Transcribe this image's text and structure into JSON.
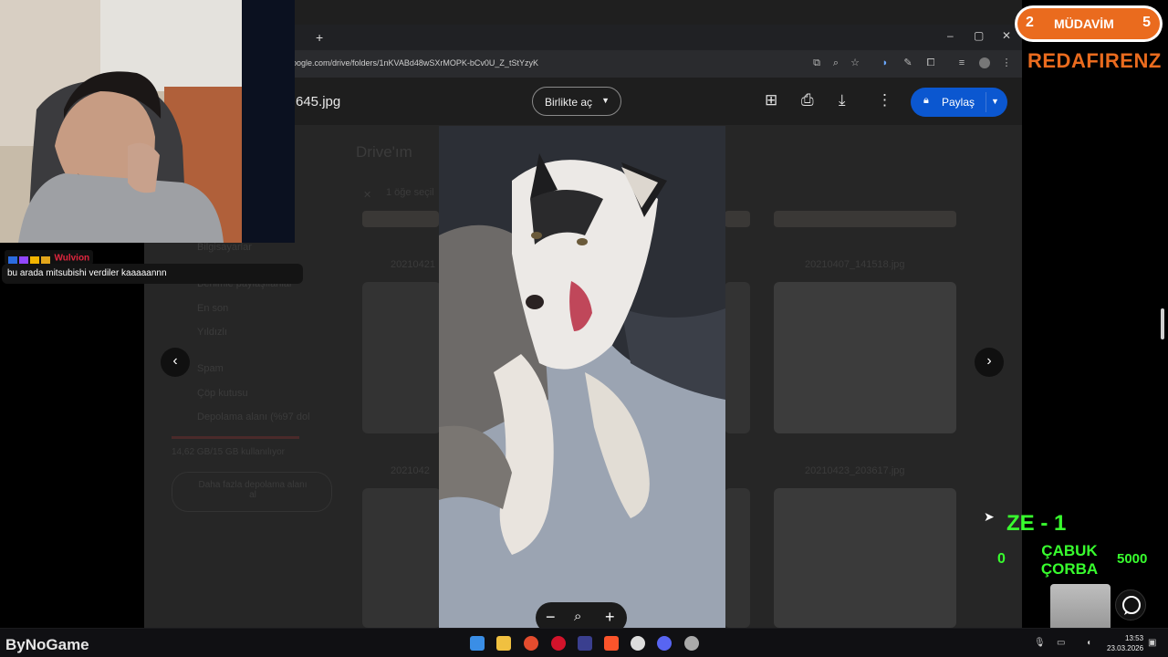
{
  "browser": {
    "new_tab": "+",
    "url": "oogle.com/drive/folders/1nKVABd48wSXrMOPK-bCv0U_Z_tStYzyK",
    "window_controls": [
      "–",
      "▢",
      "✕"
    ]
  },
  "viewer": {
    "filename": "645.jpg",
    "open_with": "Birlikte aç",
    "share": "Paylaş"
  },
  "drive_background": {
    "title": "Drive'ım",
    "selected": "1 öğe seçil",
    "sidebar": [
      "Bilgisayarlar",
      "Benimle paylaşılanlar",
      "En son",
      "Yıldızlı",
      "Spam",
      "Çöp kutusu",
      "Depolama alanı (%97 dol"
    ],
    "storage_text": "14,62 GB/15 GB kullanılıyor",
    "buy_storage": "Daha fazla depolama alanı al",
    "files": [
      "20210421",
      "20210407_141518.jpg",
      "2021042",
      "20210423_203617.jpg"
    ]
  },
  "chat": {
    "username": "Wulvion",
    "message": "bu arada mitsubishi verdiler kaaaaannn"
  },
  "overlay": {
    "left_num": "2",
    "label": "MÜDAVİM",
    "right_num": "5",
    "marquee": "REDAFIRENZ",
    "score": "ZE - 1",
    "zero": "0",
    "soup": "ÇABUK ÇORBA",
    "points": "5000"
  },
  "taskbar": {
    "brand": "ByNoGame",
    "time": "13:53",
    "date": "23.03.2026"
  }
}
